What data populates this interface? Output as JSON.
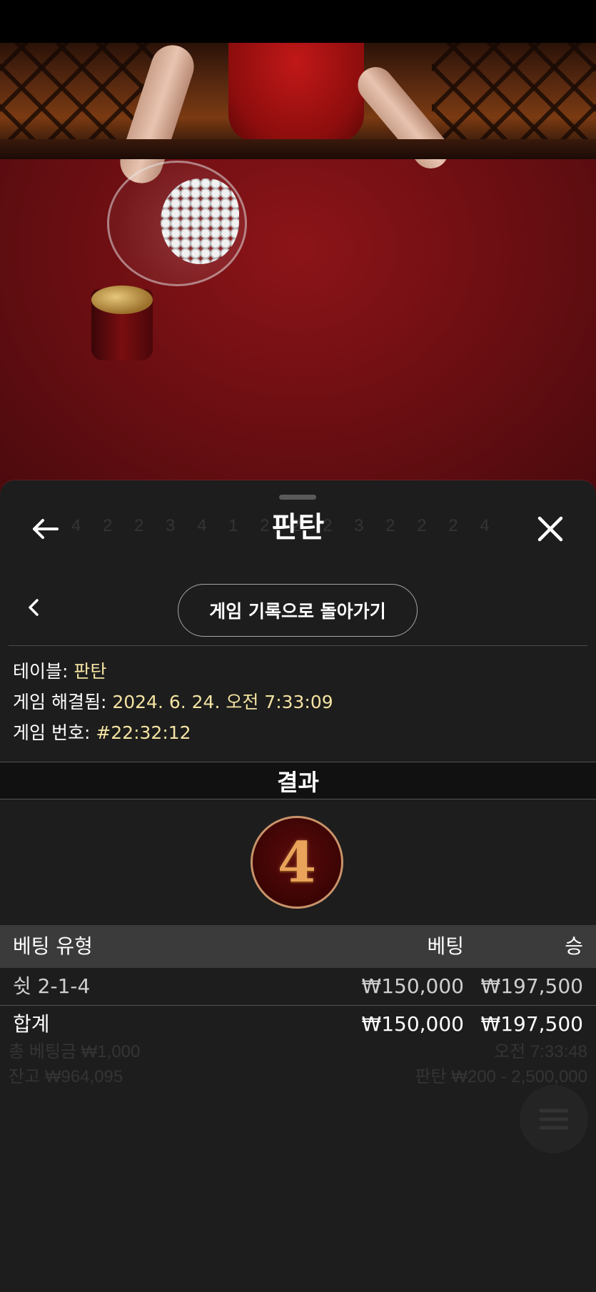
{
  "header": {
    "title": "판탄"
  },
  "navigation": {
    "back_to_history_label": "게임 기록으로 돌아가기"
  },
  "game_info": {
    "table_label": "테이블:",
    "table_value": "판탄",
    "resolved_label": "게임 해결됨:",
    "resolved_value": "2024. 6. 24. 오전 7:33:09",
    "number_label": "게임 번호:",
    "number_value": "#22:32:12"
  },
  "result": {
    "heading": "결과",
    "value": "4"
  },
  "bets_table": {
    "headers": {
      "type": "베팅 유형",
      "bet": "베팅",
      "win": "승"
    },
    "rows": [
      {
        "type": "쉿 2-1-4",
        "bet": "₩150,000",
        "win": "₩197,500"
      }
    ],
    "total": {
      "label": "합계",
      "bet": "₩150,000",
      "win": "₩197,500"
    }
  },
  "background_overlay": {
    "history_strip": "4  2  2  3  4  1  2  2  2  3  2  2  2  4",
    "total_bet": "총 베팅금 ₩1,000",
    "balance": "잔고 ₩964,095",
    "table_limit": "판탄 ₩200 - 2,500,000",
    "time": "오전 7:33:48"
  },
  "icons": {
    "back": "arrow-left-icon",
    "close": "close-icon",
    "prev": "chevron-left-icon",
    "menu": "menu-icon"
  }
}
